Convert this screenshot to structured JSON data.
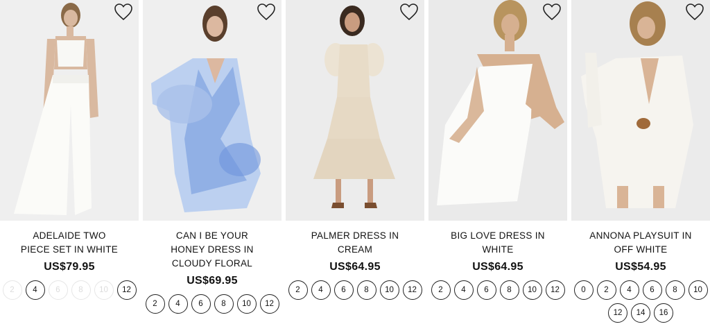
{
  "products": [
    {
      "name": "ADELAIDE TWO PIECE SET IN WHITE",
      "price": "US$79.95",
      "wishlist_icon": "heart-outline-icon",
      "sizes": [
        {
          "label": "2",
          "available": false
        },
        {
          "label": "4",
          "available": true
        },
        {
          "label": "6",
          "available": false
        },
        {
          "label": "8",
          "available": false
        },
        {
          "label": "10",
          "available": false
        },
        {
          "label": "12",
          "available": true
        }
      ]
    },
    {
      "name": "CAN I BE YOUR HONEY DRESS IN CLOUDY FLORAL",
      "price": "US$69.95",
      "wishlist_icon": "heart-outline-icon",
      "sizes": [
        {
          "label": "2",
          "available": true
        },
        {
          "label": "4",
          "available": true
        },
        {
          "label": "6",
          "available": true
        },
        {
          "label": "8",
          "available": true
        },
        {
          "label": "10",
          "available": true
        },
        {
          "label": "12",
          "available": true
        }
      ]
    },
    {
      "name": "PALMER DRESS IN CREAM",
      "price": "US$64.95",
      "wishlist_icon": "heart-outline-icon",
      "sizes": [
        {
          "label": "2",
          "available": true
        },
        {
          "label": "4",
          "available": true
        },
        {
          "label": "6",
          "available": true
        },
        {
          "label": "8",
          "available": true
        },
        {
          "label": "10",
          "available": true
        },
        {
          "label": "12",
          "available": true
        }
      ]
    },
    {
      "name": "BIG LOVE DRESS IN WHITE",
      "price": "US$64.95",
      "wishlist_icon": "heart-outline-icon",
      "sizes": [
        {
          "label": "2",
          "available": true
        },
        {
          "label": "4",
          "available": true
        },
        {
          "label": "6",
          "available": true
        },
        {
          "label": "8",
          "available": true
        },
        {
          "label": "10",
          "available": true
        },
        {
          "label": "12",
          "available": true
        }
      ]
    },
    {
      "name": "ANNONA PLAYSUIT IN OFF WHITE",
      "price": "US$54.95",
      "wishlist_icon": "heart-outline-icon",
      "sizes": [
        {
          "label": "0",
          "available": true
        },
        {
          "label": "2",
          "available": true
        },
        {
          "label": "4",
          "available": true
        },
        {
          "label": "6",
          "available": true
        },
        {
          "label": "8",
          "available": true
        },
        {
          "label": "10",
          "available": true
        },
        {
          "label": "12",
          "available": true
        },
        {
          "label": "14",
          "available": true
        },
        {
          "label": "16",
          "available": true
        }
      ]
    }
  ],
  "colors": {
    "photo_background": "#efefef",
    "size_border": "#222222",
    "size_unavailable": "#e6e6e6"
  }
}
